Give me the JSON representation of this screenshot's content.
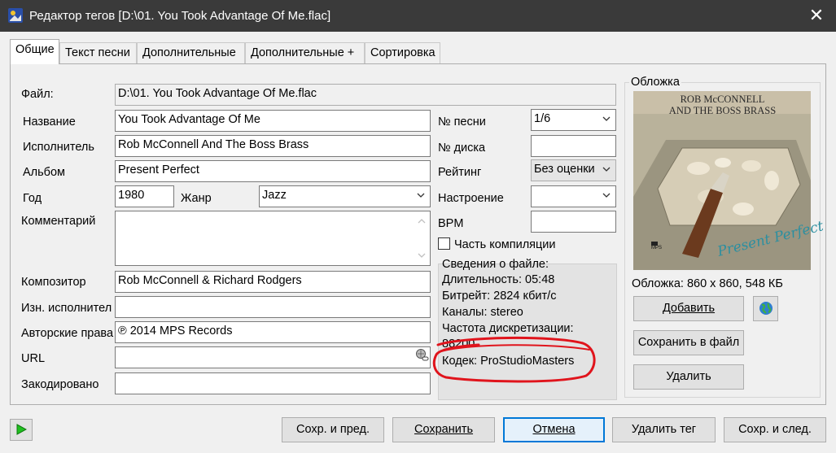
{
  "window": {
    "title": "Редактор тегов [D:\\01. You Took Advantage Of Me.flac]",
    "close_glyph": "✕"
  },
  "tabs": [
    {
      "label": "Общие",
      "active": true
    },
    {
      "label": "Текст песни"
    },
    {
      "label": "Дополнительные"
    },
    {
      "label": "Дополнительные +"
    },
    {
      "label": "Сортировка"
    }
  ],
  "fields": {
    "file": {
      "label": "Файл:",
      "value": "D:\\01. You Took Advantage Of Me.flac"
    },
    "title": {
      "label": "Название",
      "value": "You Took Advantage Of Me"
    },
    "artist": {
      "label": "Исполнитель",
      "value": "Rob McConnell And The Boss Brass"
    },
    "album": {
      "label": "Альбом",
      "value": "Present Perfect"
    },
    "year": {
      "label": "Год",
      "value": "1980"
    },
    "genre": {
      "label": "Жанр",
      "value": "Jazz"
    },
    "comment": {
      "label": "Комментарий",
      "value": ""
    },
    "composer": {
      "label": "Композитор",
      "value": "Rob McConnell & Richard Rodgers"
    },
    "orig_artist": {
      "label": "Изн. исполнител",
      "value": ""
    },
    "copyright": {
      "label": "Авторские права",
      "value": "℗ 2014 MPS Records"
    },
    "url": {
      "label": "URL",
      "value": ""
    },
    "encoded_by": {
      "label": "Закодировано",
      "value": ""
    },
    "track": {
      "label": "№ песни",
      "value": "1/6"
    },
    "disc": {
      "label": "№ диска",
      "value": ""
    },
    "rating": {
      "label": "Рейтинг",
      "value": "Без оценки"
    },
    "mood": {
      "label": "Настроение",
      "value": ""
    },
    "bpm": {
      "label": "BPM",
      "value": ""
    },
    "compilation": {
      "label": "Часть компиляции",
      "checked": false
    }
  },
  "file_info": {
    "heading": "Сведения о файле:",
    "duration": "Длительность: 05:48",
    "bitrate": "Битрейт: 2824 кбит/с",
    "channels": "Каналы: stereo",
    "samplerate_label": "Частота дискретизации:",
    "samplerate_value": "88200",
    "codec": "Кодек: ProStudioMasters"
  },
  "cover": {
    "heading": "Обложка",
    "info": "Обложка: 860 x 860, 548 КБ",
    "art_title_line1": "ROB McCONNELL",
    "art_title_line2": "AND THE BOSS BRASS",
    "art_script": "Present Perfect",
    "art_label": "MPS",
    "add_label": "Добавить",
    "save_label": "Сохранить в файл",
    "delete_label": "Удалить"
  },
  "buttons": {
    "save_prev": "Сохр. и пред.",
    "save": "Сохранить",
    "cancel": "Отмена",
    "delete_tag": "Удалить тег",
    "save_next": "Сохр. и след."
  },
  "colors": {
    "titlebar": "#3a3a3a",
    "accent": "#0078d7",
    "annotation": "#e0141c",
    "play": "#1fbf1f"
  }
}
